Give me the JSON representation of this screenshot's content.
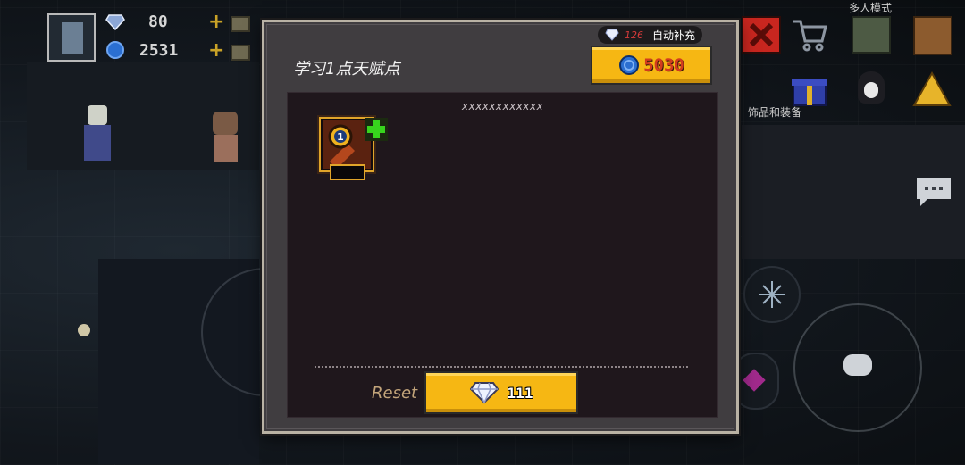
{
  "hud": {
    "gems": "80",
    "coins": "2531"
  },
  "scene": {
    "multiplayer_label": "多人模式",
    "accessories_label": "饰品和装备"
  },
  "modal": {
    "gem_count": "126",
    "auto_refill_label": "自动补充",
    "title": "学习1点天赋点",
    "coin_cost": "5030",
    "placeholder_text": "xxxxxxxxxxxx",
    "talent_level": "1",
    "reset_label": "Reset",
    "reset_gem_cost": "111"
  },
  "colors": {
    "accent_gold": "#f6b713",
    "coin_text": "#d23c1e",
    "gem_count": "#d43a3a",
    "panel_bg": "#1f171c"
  },
  "icons": [
    "player-avatar",
    "gem-icon",
    "coin-icon",
    "close-icon",
    "cart-icon",
    "gift-icon",
    "chat-icon",
    "plus-icon",
    "talent-icon",
    "snowflake-icon"
  ]
}
